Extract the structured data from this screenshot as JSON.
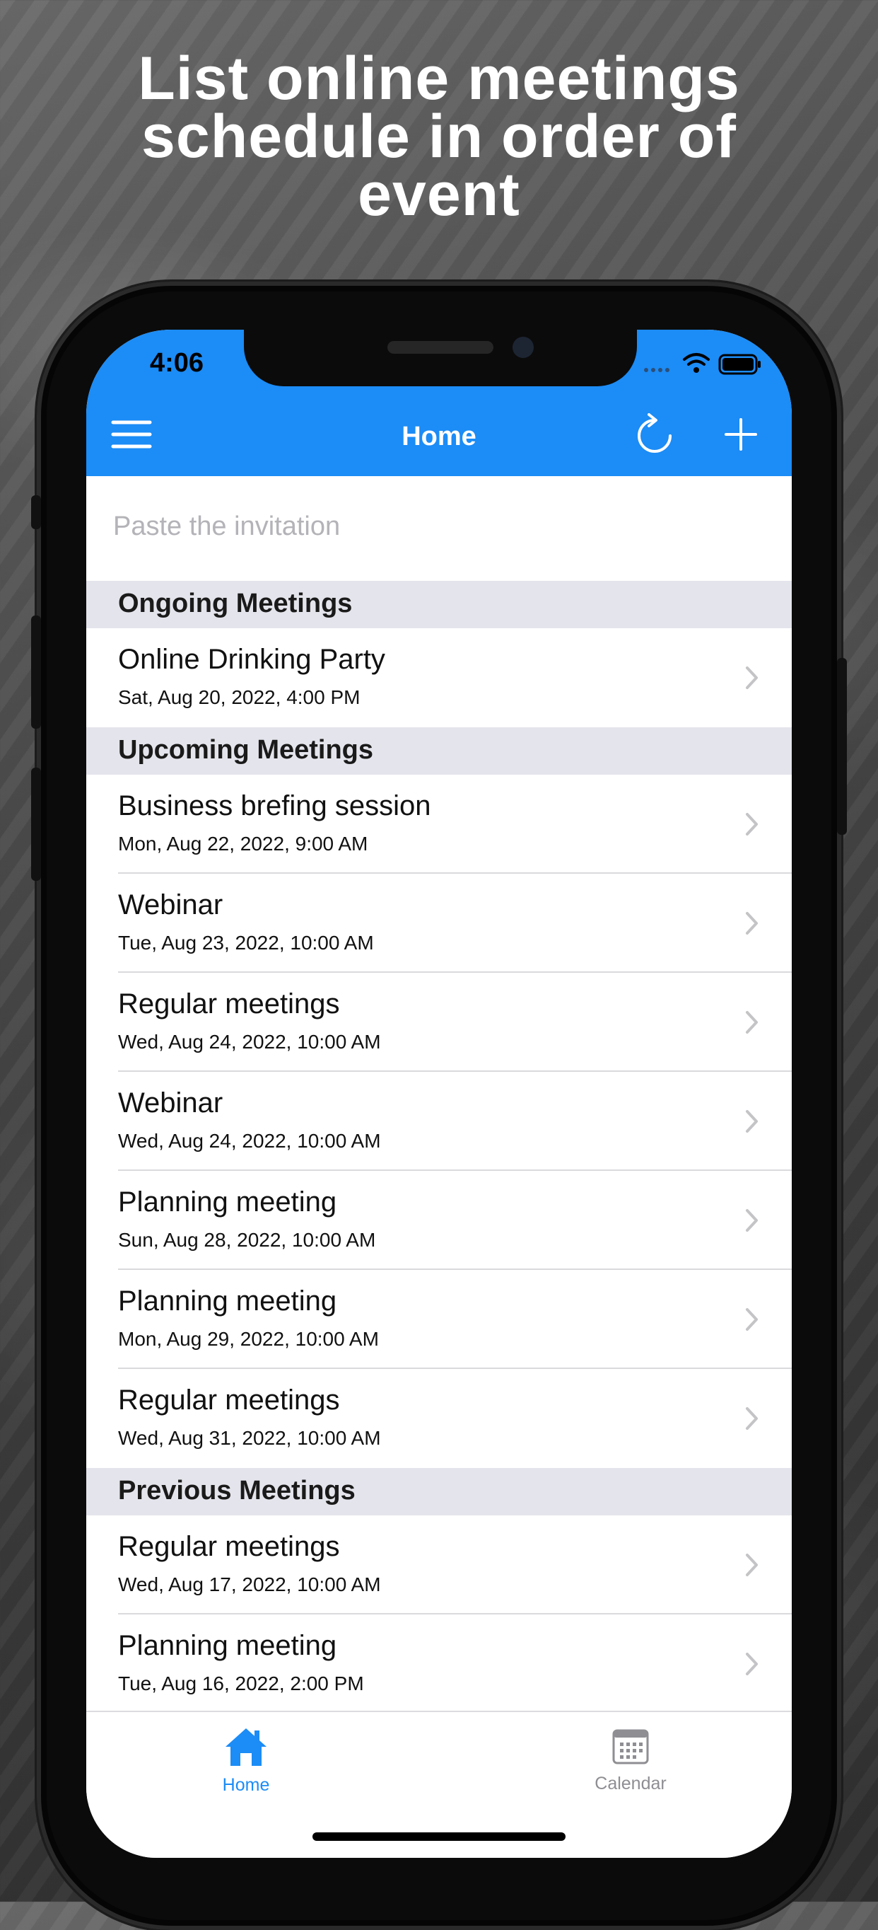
{
  "headline": {
    "line1": "List online meetings",
    "line2": "schedule in order of",
    "line3": "event"
  },
  "status_bar": {
    "time": "4:06"
  },
  "navbar": {
    "title": "Home",
    "menu_icon": "hamburger-menu-icon",
    "refresh_icon": "refresh-icon",
    "add_icon": "plus-icon"
  },
  "invite_input": {
    "placeholder": "Paste the invitation",
    "value": ""
  },
  "sections": [
    {
      "header": "Ongoing Meetings",
      "items": [
        {
          "title": "Online Drinking Party",
          "date": "Sat, Aug 20, 2022, 4:00 PM"
        }
      ]
    },
    {
      "header": "Upcoming Meetings",
      "items": [
        {
          "title": "Business brefing session",
          "date": "Mon, Aug 22, 2022, 9:00 AM"
        },
        {
          "title": "Webinar",
          "date": "Tue, Aug 23, 2022, 10:00 AM"
        },
        {
          "title": "Regular meetings",
          "date": "Wed, Aug 24, 2022, 10:00 AM"
        },
        {
          "title": "Webinar",
          "date": "Wed, Aug 24, 2022, 10:00 AM"
        },
        {
          "title": "Planning meeting",
          "date": "Sun, Aug 28, 2022, 10:00 AM"
        },
        {
          "title": "Planning meeting",
          "date": "Mon, Aug 29, 2022, 10:00 AM"
        },
        {
          "title": "Regular meetings",
          "date": "Wed, Aug 31, 2022, 10:00 AM"
        }
      ]
    },
    {
      "header": "Previous Meetings",
      "items": [
        {
          "title": "Regular meetings",
          "date": "Wed, Aug 17, 2022, 10:00 AM"
        },
        {
          "title": "Planning meeting",
          "date": "Tue, Aug 16, 2022, 2:00 PM"
        }
      ]
    }
  ],
  "tabbar": {
    "tabs": [
      {
        "label": "Home",
        "icon": "house-icon",
        "selected": true
      },
      {
        "label": "Calendar",
        "icon": "calendar-icon",
        "selected": false
      }
    ]
  },
  "colors": {
    "accent": "#1c8cf6",
    "section_header_bg": "#e4e4ec",
    "tab_inactive": "#8e8e93"
  }
}
